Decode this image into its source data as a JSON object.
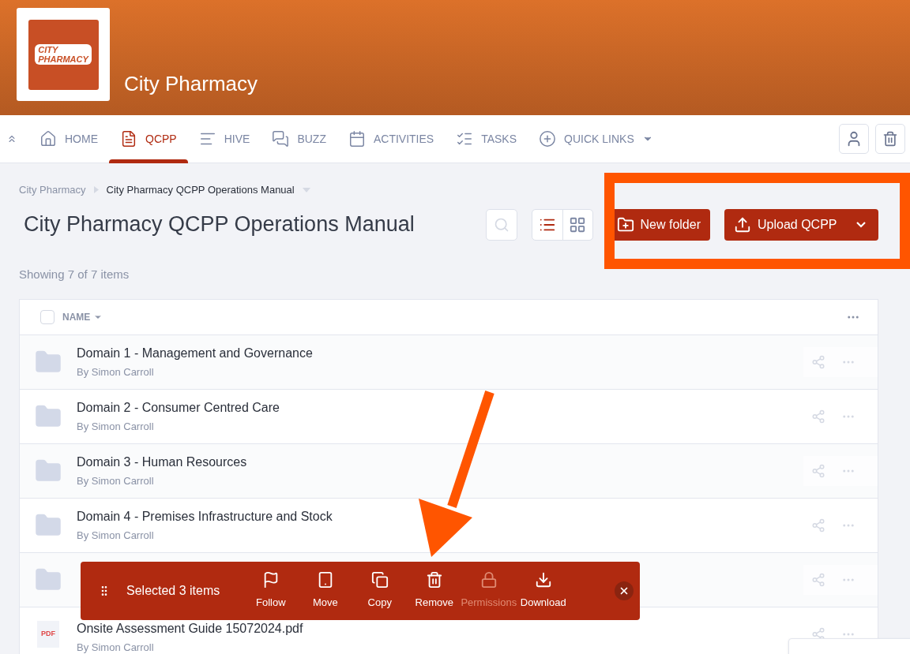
{
  "header": {
    "logo_lines": [
      "CITY",
      "PHARMACY"
    ],
    "title": "City Pharmacy"
  },
  "nav": [
    {
      "kind": "home",
      "label": "HOME",
      "selected": false
    },
    {
      "kind": "doc",
      "label": "QCPP",
      "selected": true
    },
    {
      "kind": "lines",
      "label": "HIVE",
      "selected": false
    },
    {
      "kind": "chat",
      "label": "BUZZ",
      "selected": false
    },
    {
      "kind": "calendar",
      "label": "ACTIVITIES",
      "selected": false
    },
    {
      "kind": "tasks",
      "label": "TASKS",
      "selected": false
    },
    {
      "kind": "plus",
      "label": "QUICK LINKS",
      "selected": false,
      "dropdown": true
    }
  ],
  "breadcrumb": [
    "City Pharmacy",
    "City Pharmacy QCPP Operations Manual"
  ],
  "page_title": "City Pharmacy QCPP Operations Manual",
  "view_toggle": [
    {
      "kind": "list",
      "selected": true
    },
    {
      "kind": "grid",
      "selected": false
    }
  ],
  "buttons": {
    "new_folder": "New folder",
    "upload": "Upload QCPP"
  },
  "count": "Showing 7 of 7 items",
  "table": {
    "select_all_checked": false,
    "column": "NAME",
    "rows": [
      {
        "kind": "folder",
        "title": "Domain 1 - Management and Governance",
        "author": "By Simon Carroll"
      },
      {
        "kind": "folder",
        "title": "Domain 2 - Consumer Centred Care",
        "author": "By Simon Carroll"
      },
      {
        "kind": "folder",
        "title": "Domain 3 - Human Resources",
        "author": "By Simon Carroll"
      },
      {
        "kind": "folder",
        "title": "Domain 4 - Premises Infrastructure and Stock",
        "author": "By Simon Carroll"
      },
      {
        "kind": "folder"
      },
      {
        "kind": "pdf",
        "badge": "PDF",
        "title": "Onsite Assessment Guide 15072024.pdf",
        "author": "By Simon Carroll"
      }
    ]
  },
  "selection_bar": {
    "label": "Selected 3 items",
    "actions": [
      {
        "kind": "flag",
        "label": "Follow",
        "disabled": false
      },
      {
        "kind": "move",
        "label": "Move",
        "disabled": false
      },
      {
        "kind": "copy",
        "label": "Copy",
        "disabled": false
      },
      {
        "kind": "trash",
        "label": "Remove",
        "disabled": false
      },
      {
        "kind": "lock",
        "label": "Permissions",
        "disabled": true
      },
      {
        "kind": "download",
        "label": "Download",
        "disabled": false
      }
    ]
  }
}
